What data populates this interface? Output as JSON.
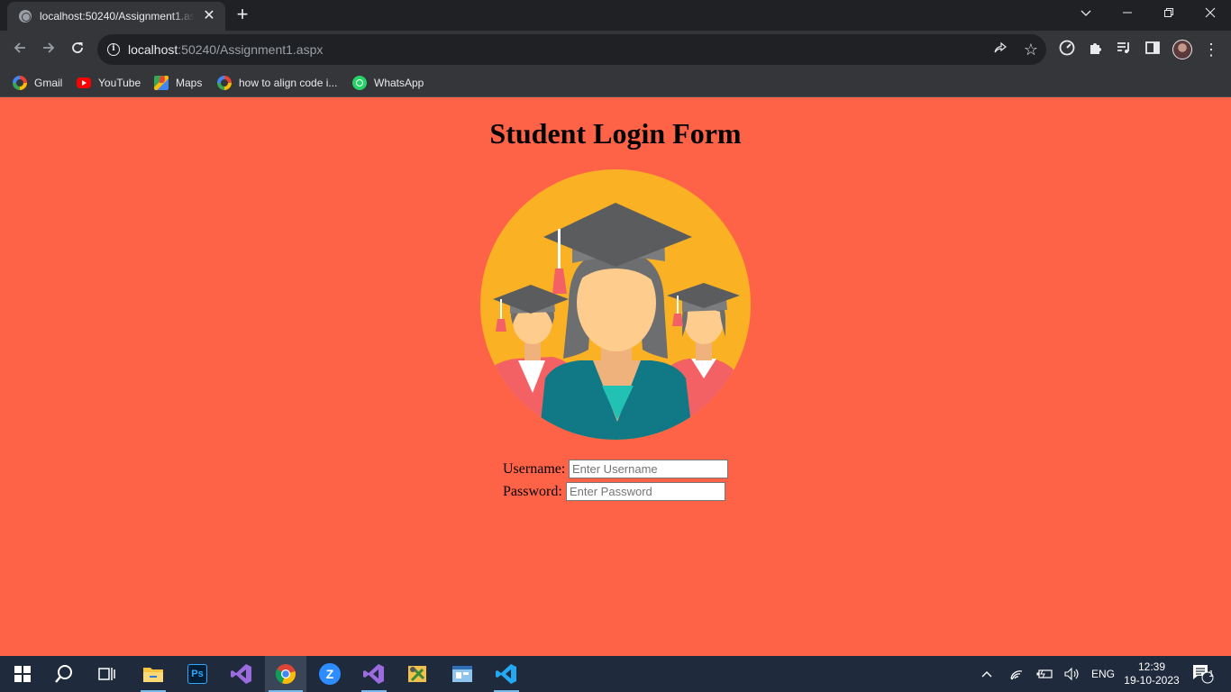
{
  "browser": {
    "tab_title": "localhost:50240/Assignment1.aspx",
    "tab_close": "✕",
    "new_tab": "+",
    "url_host": "localhost",
    "url_rest": ":50240/Assignment1.aspx",
    "bookmarks": [
      {
        "label": "Gmail",
        "icon": "google-icon"
      },
      {
        "label": "YouTube",
        "icon": "youtube-icon"
      },
      {
        "label": "Maps",
        "icon": "maps-icon"
      },
      {
        "label": "how to align code i...",
        "icon": "google-icon"
      },
      {
        "label": "WhatsApp",
        "icon": "whatsapp-icon"
      }
    ]
  },
  "page": {
    "title": "Student Login Form",
    "background_color": "#ff6347",
    "logo_icon": "graduates-icon",
    "form": {
      "username_label": "Username:",
      "username_placeholder": "Enter Username",
      "username_value": "",
      "password_label": "Password:",
      "password_placeholder": "Enter Password",
      "password_value": ""
    }
  },
  "taskbar": {
    "apps": [
      "start",
      "search",
      "task-view",
      "file-explorer",
      "photoshop",
      "visual-studio",
      "chrome",
      "zoom",
      "visual-studio",
      "tool",
      "app",
      "vscode"
    ],
    "language": "ENG",
    "time": "12:39",
    "date": "19-10-2023",
    "notification_count": "1"
  }
}
